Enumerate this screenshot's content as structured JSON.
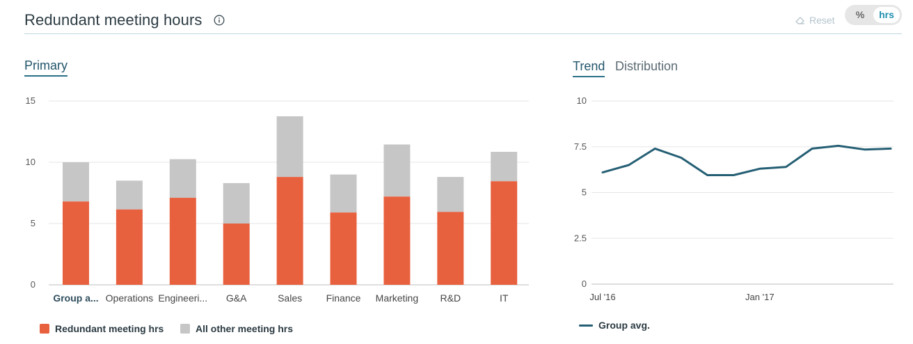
{
  "header": {
    "title": "Redundant meeting hours",
    "reset_label": "Reset",
    "toggle": {
      "percent_label": "%",
      "hours_label": "hrs",
      "selected": "hrs"
    }
  },
  "left_panel": {
    "tab_primary": "Primary"
  },
  "right_panel": {
    "tab_trend": "Trend",
    "tab_distribution": "Distribution",
    "selected": "Trend"
  },
  "colors": {
    "redundant": "#e8613f",
    "other": "#c6c6c6",
    "trend_line": "#255f74",
    "accent": "#2a6f86"
  },
  "chart_data": [
    {
      "type": "bar",
      "stacked": true,
      "categories": [
        "Group a...",
        "Operations",
        "Engineeri...",
        "G&A",
        "Sales",
        "Finance",
        "Marketing",
        "R&D",
        "IT"
      ],
      "series": [
        {
          "name": "Redundant meeting hrs",
          "values": [
            6.8,
            6.15,
            7.1,
            5.0,
            8.8,
            5.9,
            7.2,
            5.95,
            8.45
          ]
        },
        {
          "name": "All other meeting hrs",
          "values": [
            3.2,
            2.35,
            3.15,
            3.3,
            4.95,
            3.1,
            4.25,
            2.85,
            2.4
          ]
        }
      ],
      "yticks": [
        "0",
        "5",
        "10",
        "15"
      ],
      "ylim": [
        0,
        15
      ],
      "grid": true,
      "legend": "bottom-left"
    },
    {
      "type": "line",
      "x": [
        "Jul '16",
        "Aug '16",
        "Sep '16",
        "Oct '16",
        "Nov '16",
        "Dec '16",
        "Jan '17",
        "Feb '17",
        "Mar '17",
        "Apr '17",
        "May '17",
        "Jun '17"
      ],
      "xticks": [
        "Jul '16",
        "Jan '17"
      ],
      "series": [
        {
          "name": "Group avg.",
          "values": [
            6.1,
            6.5,
            7.4,
            6.9,
            5.95,
            5.95,
            6.3,
            6.4,
            7.4,
            7.55,
            7.35,
            7.4
          ]
        }
      ],
      "yticks": [
        "0",
        "2.5",
        "5",
        "7.5",
        "10"
      ],
      "ylim": [
        0,
        10
      ],
      "grid": true,
      "legend": "bottom-left"
    }
  ]
}
